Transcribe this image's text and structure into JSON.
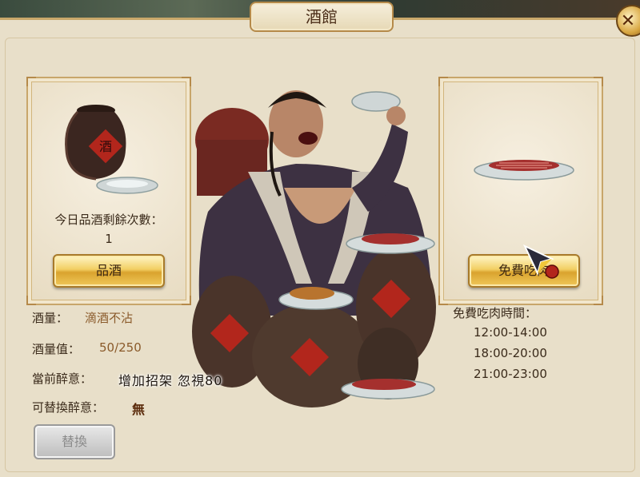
{
  "title": "酒館",
  "close_glyph": "✕",
  "left_card": {
    "remaining_label": "今日品酒剩餘次數：",
    "remaining_value": "1",
    "button_label": "品酒"
  },
  "right_card": {
    "button_label": "免費吃肉"
  },
  "stats": {
    "capacity_label": "酒量：",
    "capacity_value": "滴酒不沾",
    "capacity_points_label": "酒量值：",
    "capacity_points_value": "50/250",
    "current_buff_label": "當前醉意：",
    "current_buff_value": "增加招架 忽視80",
    "replaceable_label": "可替換醉意：",
    "replaceable_value": "無",
    "replace_button_label": "替換"
  },
  "free_meat": {
    "title": "免費吃肉時間：",
    "slots": [
      "12:00-14:00",
      "18:00-20:00",
      "21:00-23:00"
    ]
  },
  "colors": {
    "panel_bg": "#e8dfc9",
    "gold_button": "#f2cf63",
    "label_text": "#3a2a1a",
    "value_text": "#8a5a2a",
    "disabled_button": "#bdbdbd"
  },
  "icons": [
    "close-icon",
    "wine-jar-icon",
    "wine-dish-icon",
    "meat-plate-icon",
    "cursor-icon"
  ]
}
